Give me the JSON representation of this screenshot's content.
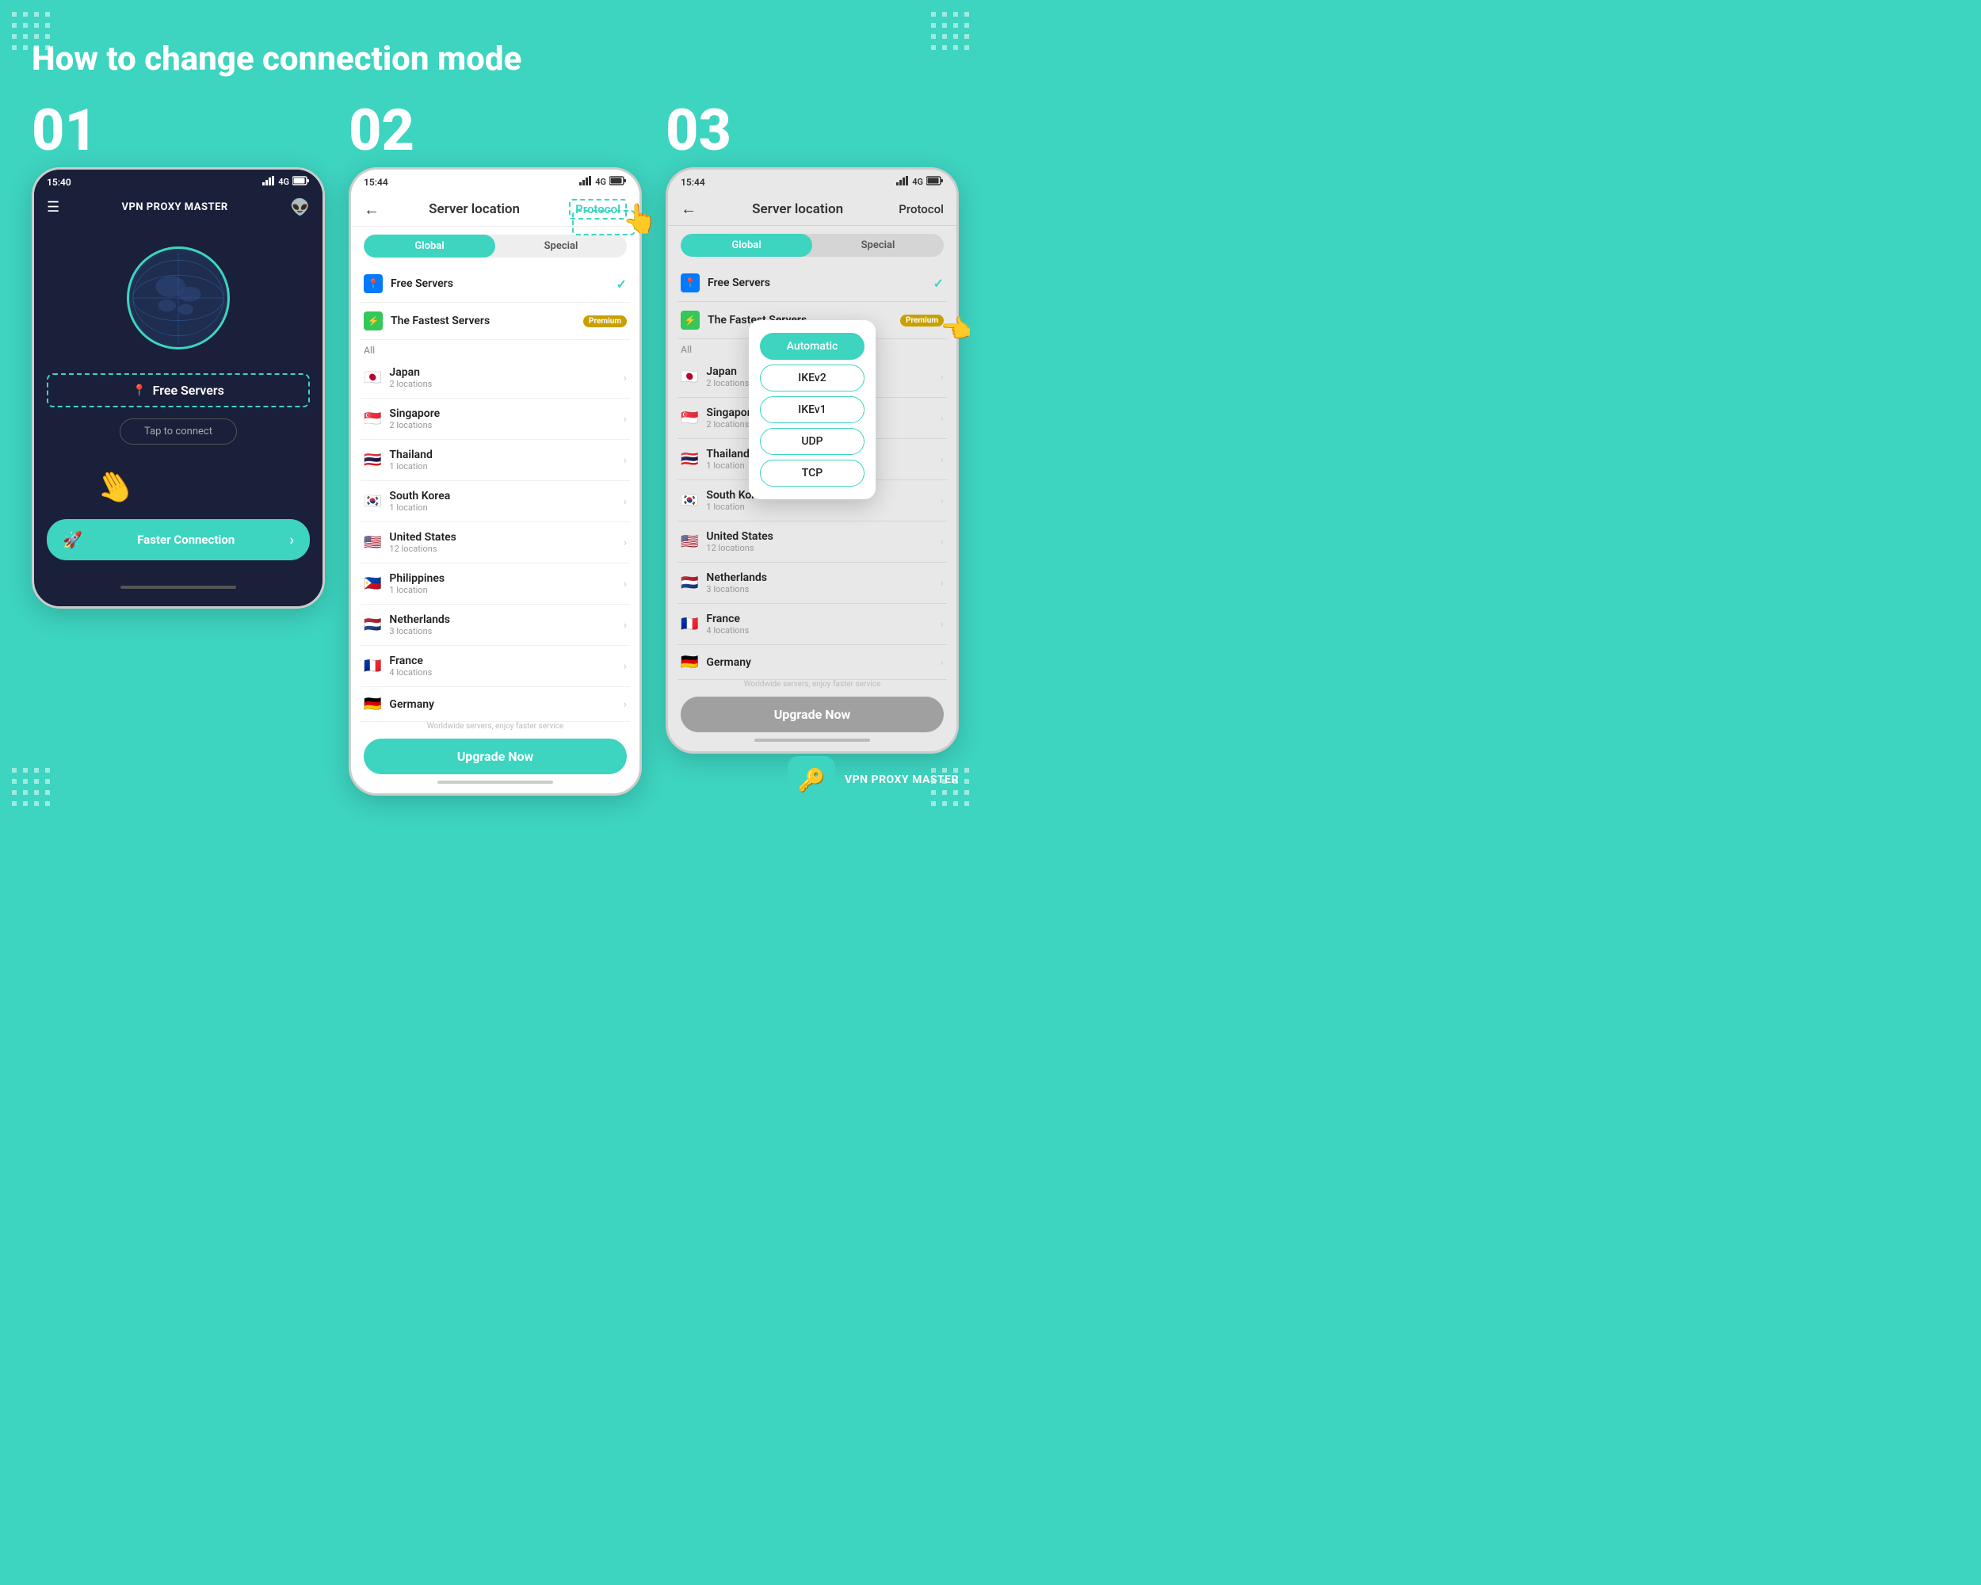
{
  "page": {
    "title": "How to change connection mode",
    "background_color": "#3dd4c0"
  },
  "steps": [
    {
      "number": "01",
      "phone": {
        "time": "15:40",
        "signal": "4G",
        "header": {
          "logo": "VPN PROXY MASTER"
        },
        "free_servers_label": "Free Servers",
        "tap_connect": "Tap to connect",
        "faster_connection": "Faster Connection",
        "home_bar": true
      }
    },
    {
      "number": "02",
      "phone": {
        "time": "15:44",
        "signal": "4G",
        "title": "Server location",
        "protocol_label": "Protocol",
        "tabs": [
          "Global",
          "Special"
        ],
        "active_tab": 0,
        "section_label": "All",
        "servers": [
          {
            "name": "Free Servers",
            "sub": "",
            "type": "free",
            "check": true
          },
          {
            "name": "The Fastest Servers",
            "sub": "",
            "type": "fastest",
            "premium": true
          }
        ],
        "countries": [
          {
            "name": "Japan",
            "sub": "2 locations",
            "flag": "🇯🇵"
          },
          {
            "name": "Singapore",
            "sub": "2 locations",
            "flag": "🇸🇬"
          },
          {
            "name": "Thailand",
            "sub": "1 location",
            "flag": "🇹🇭"
          },
          {
            "name": "South Korea",
            "sub": "1 location",
            "flag": "🇰🇷"
          },
          {
            "name": "United States",
            "sub": "12 locations",
            "flag": "🇺🇸"
          },
          {
            "name": "Philippines",
            "sub": "1 location",
            "flag": "🇵🇭"
          },
          {
            "name": "Netherlands",
            "sub": "3 locations",
            "flag": "🇳🇱"
          },
          {
            "name": "France",
            "sub": "4 locations",
            "flag": "🇫🇷"
          },
          {
            "name": "Germany",
            "sub": "",
            "flag": "🇩🇪"
          }
        ],
        "worldwide_text": "Worldwide servers, enjoy faster service",
        "upgrade_btn": "Upgrade Now"
      }
    },
    {
      "number": "03",
      "phone": {
        "time": "15:44",
        "signal": "4G",
        "title": "Server location",
        "protocol_label": "Protocol",
        "tabs": [
          "Global",
          "Special"
        ],
        "active_tab": 0,
        "section_label": "All",
        "servers": [
          {
            "name": "Free Servers",
            "sub": "",
            "type": "free",
            "check": true
          },
          {
            "name": "The Fastest Servers",
            "sub": "",
            "type": "fastest",
            "premium": true
          }
        ],
        "countries": [
          {
            "name": "Japan",
            "sub": "2 l...",
            "flag": "🇯🇵"
          },
          {
            "name": "Singapore",
            "sub": "2 l...",
            "flag": "🇸🇬"
          },
          {
            "name": "Thailand",
            "sub": "1 l...",
            "flag": "🇹🇭"
          },
          {
            "name": "South Korea",
            "sub": "1 l...",
            "flag": "🇰🇷"
          },
          {
            "name": "United States",
            "sub": "12...",
            "flag": "🇺🇸"
          },
          {
            "name": "Netherlands",
            "sub": "3 locations",
            "flag": "🇳🇱"
          },
          {
            "name": "France",
            "sub": "4 locations",
            "flag": "🇫🇷"
          },
          {
            "name": "Germany",
            "sub": "",
            "flag": "🇩🇪"
          }
        ],
        "worldwide_text": "Worldwide servers, enjoy faster service",
        "upgrade_btn": "Upgrade Now",
        "protocol_popup": {
          "options": [
            "Automatic",
            "IKEv2",
            "IKEv1",
            "UDP",
            "TCP"
          ],
          "active": 0
        }
      }
    }
  ],
  "branding": {
    "icon": "🔑",
    "name": "VPN PROXY MASTER"
  }
}
